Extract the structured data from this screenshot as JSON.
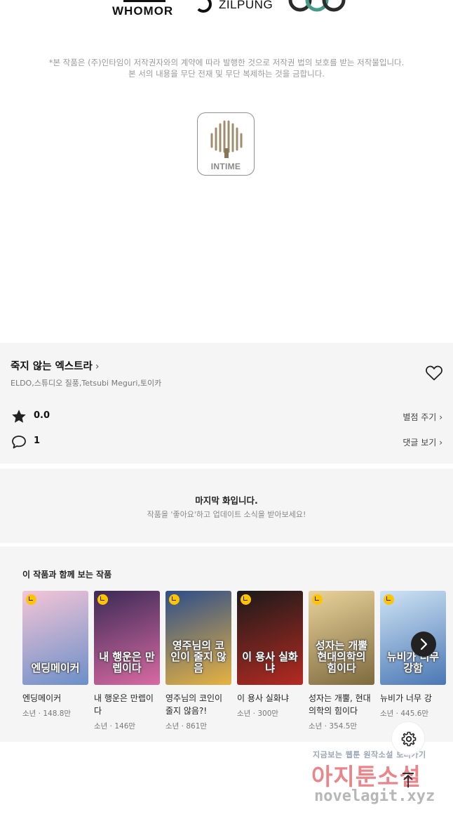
{
  "publishers": {
    "whomor": "WHOMOR",
    "zilpung": "ZILPUNG",
    "intime": "INTIME"
  },
  "notice": {
    "line1": "*본 작품은 (주)인타임이 저작권자와의 계약에 따라 발행한 것으로 저작권 법의 보호를 받는 저작물입니다.",
    "line2": "본 서의 내용을 무단 전재 및 무단 복제하는 것을 금합니다."
  },
  "work": {
    "title": "죽지 않는 엑스트라",
    "title_chevron": "›",
    "authors": "ELDO,스튜디오 질풍,Tetsubi Meguri,토이카",
    "rating": "0.0",
    "rating_link": "별점 주기",
    "comments": "1",
    "comments_link": "댓글 보기",
    "link_chevron": "›"
  },
  "last_episode": {
    "title": "마지막 화입니다.",
    "subtitle": "작품을 '좋아요'하고 업데이트 소식을 받아보세요!"
  },
  "related": {
    "heading": "이 작품과 함께 보는 작품",
    "items": [
      {
        "title": "엔딩메이커",
        "meta": "소년 · 148.8만",
        "caption": "엔딩메이커",
        "color_a": "#f4c5d6",
        "color_b": "#6b8fc9"
      },
      {
        "title": "내 행운은 만렙이다",
        "meta": "소년 · 146만",
        "caption": "내 행운은 만렙이다",
        "color_a": "#3b2a55",
        "color_b": "#d86aa3"
      },
      {
        "title": "영주님의 코인이 줄지 않음?!",
        "meta": "소년 · 861만",
        "caption": "영주님의 코인이 줄지 않음",
        "color_a": "#2d4d8a",
        "color_b": "#e7b341"
      },
      {
        "title": "이 용사 실화냐",
        "meta": "소년 · 300만",
        "caption": "이 용사 실화냐",
        "color_a": "#1a1a1a",
        "color_b": "#b52a22"
      },
      {
        "title": "성자는 개뿔, 현대의학의 힘이다",
        "meta": "소년 · 354.5만",
        "caption": "성자는 개뿔 현대의학의 힘이다",
        "color_a": "#e9d29b",
        "color_b": "#7d6a3e"
      },
      {
        "title": "뉴비가 너무 강",
        "meta": "소년 · 445.6만",
        "caption": "뉴비가 너무 강함",
        "color_a": "#cfe4f4",
        "color_b": "#4a77b5"
      }
    ]
  },
  "watermark": {
    "line1": "지금보는 웹툰 원작소설 보러가기",
    "main": "아지툰소설",
    "url": "novelagit.xyz"
  },
  "colors": {
    "section_bg": "#f5f5f5",
    "badge": "#ffc400",
    "watermark_pink": "#e7868b"
  }
}
